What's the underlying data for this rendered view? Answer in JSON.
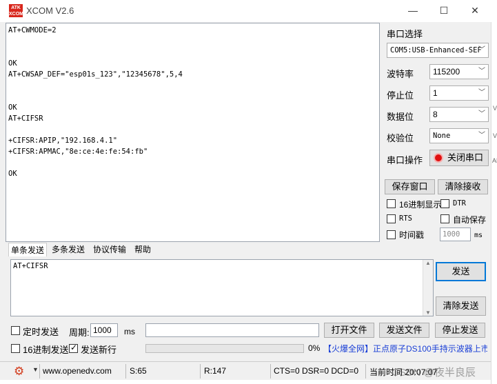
{
  "window": {
    "title": "XCOM V2.6",
    "logo_top": "ATK",
    "logo_bottom": "XCOM"
  },
  "receive": {
    "lines": "AT+CWMODE=2\n\n\nOK\nAT+CWSAP_DEF=\"esp01s_123\",\"12345678\",5,4\n\n\nOK\nAT+CIFSR\n\n+CIFSR:APIP,\"192.168.4.1\"\n+CIFSR:APMAC,\"8e:ce:4e:fe:54:fb\"\n\nOK"
  },
  "serial": {
    "section_label": "串口选择",
    "port_value": "COM5:USB-Enhanced-SEF",
    "baud_label": "波特率",
    "baud_value": "115200",
    "stop_label": "停止位",
    "stop_value": "1",
    "data_label": "数据位",
    "data_value": "8",
    "parity_label": "校验位",
    "parity_value": "None",
    "op_label": "串口操作",
    "close_button": "关闭串口"
  },
  "actions": {
    "save_window": "保存窗口",
    "clear_receive": "清除接收"
  },
  "options": {
    "hex_display": "16进制显示",
    "dtr": "DTR",
    "rts": "RTS",
    "auto_save": "自动保存",
    "timestamp": "时间戳",
    "timestamp_value": "1000",
    "timestamp_unit": "ms"
  },
  "tabs": [
    "单条发送",
    "多条发送",
    "协议传输",
    "帮助"
  ],
  "send": {
    "text": "AT+CIFSR",
    "send_button": "发送",
    "clear_send_button": "清除发送",
    "timed_send": "定时发送",
    "period_label": "周期:",
    "period_value": "1000",
    "period_unit": "ms",
    "open_file": "打开文件",
    "send_file": "发送文件",
    "stop_send": "停止发送",
    "hex_send": "16进制发送",
    "send_newline": "发送新行",
    "progress_percent": "0%",
    "progress_fraction": 0,
    "ad_text": "【火爆全网】正点原子DS100手持示波器上市"
  },
  "status": {
    "url": "www.openedv.com",
    "sent": "S:65",
    "received": "R:147",
    "lines": "CTS=0 DSR=0 DCD=0",
    "time": "当前时间 20:07:07",
    "watermark": "CSDN @夜半良辰"
  },
  "edge": {
    "a": "V",
    "b": "V",
    "c": "AL"
  },
  "colors": {
    "accent": "#0078d7",
    "logo": "#d8261c",
    "ad_blue": "#1a3fd6",
    "indicator_red": "#e01010"
  }
}
